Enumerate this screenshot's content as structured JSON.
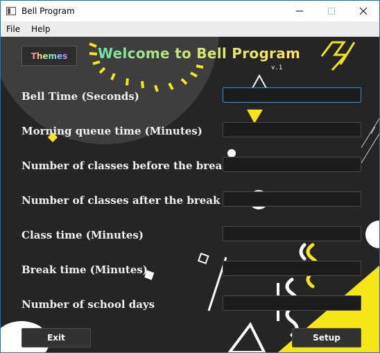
{
  "window": {
    "title": "Bell Program",
    "min_icon": "minimize-icon",
    "max_icon": "maximize-icon",
    "close_icon": "close-icon"
  },
  "menubar": {
    "items": [
      "File",
      "Help"
    ]
  },
  "header": {
    "themes_label": "Themes",
    "welcome": "Welcome to Bell Program",
    "version": "v.1"
  },
  "form": {
    "fields": [
      {
        "label": "Bell Time (Seconds)",
        "value": ""
      },
      {
        "label": "Morning queue time (Minutes)",
        "value": ""
      },
      {
        "label": "Number of classes before the break",
        "value": ""
      },
      {
        "label": "Number of classes after the break",
        "value": ""
      },
      {
        "label": "Class time (Minutes)",
        "value": ""
      },
      {
        "label": "Break time (Minutes)",
        "value": ""
      },
      {
        "label": "Number of school days",
        "value": ""
      }
    ]
  },
  "footer": {
    "exit_label": "Exit",
    "setup_label": "Setup"
  },
  "colors": {
    "accent_yellow": "#f5e61a",
    "focus_blue": "#3a8fd6",
    "background": "#252525"
  }
}
